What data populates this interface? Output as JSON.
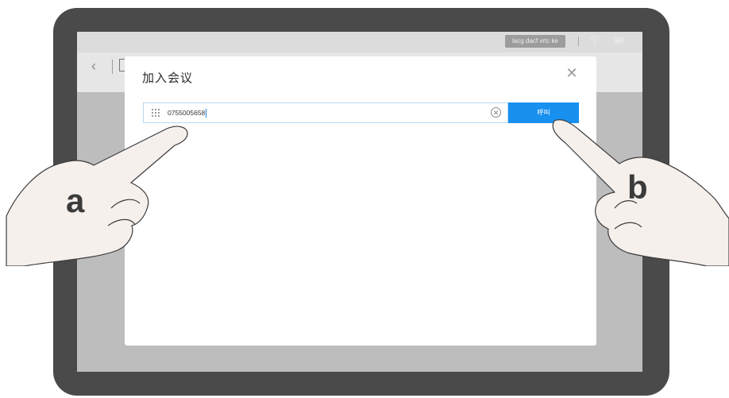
{
  "statusbar": {
    "chip_text": "lacg dacf vrtc ke"
  },
  "appbar": {
    "back_icon": "chevron-left-icon"
  },
  "dialog": {
    "title": "加入会议",
    "close_icon": "close-icon",
    "input_value": "0755005658",
    "keypad_icon": "keypad-icon",
    "clear_icon": "clear-circle-icon",
    "call_label": "呼叫"
  },
  "callouts": {
    "a": "a",
    "b": "b"
  }
}
